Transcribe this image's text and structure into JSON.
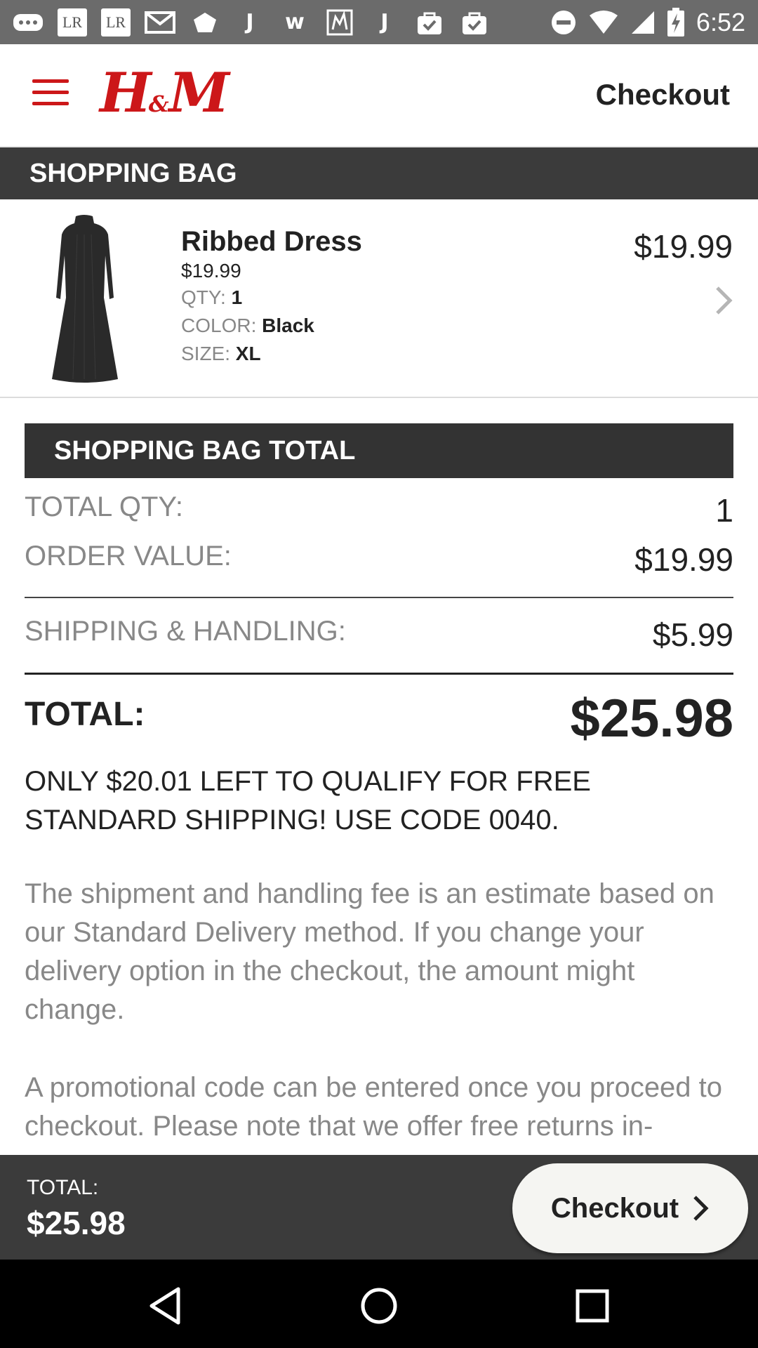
{
  "status_bar": {
    "time": "6:52",
    "icons": [
      "more-icon",
      "lr-icon",
      "lr-icon",
      "mail-icon",
      "shield-icon",
      "j-icon",
      "w-icon",
      "map-icon",
      "j-icon",
      "bag-check-icon",
      "bag-check-icon"
    ],
    "lr_label": "LR",
    "right_icons": [
      "do-not-disturb-icon",
      "wifi-icon",
      "signal-icon",
      "battery-charging-icon"
    ]
  },
  "header": {
    "brand_main": "H",
    "brand_amp": "&",
    "brand_end": "M",
    "title": "Checkout"
  },
  "shopping_bag": {
    "heading": "SHOPPING BAG",
    "items": [
      {
        "name": "Ribbed Dress",
        "unit_price": "$19.99",
        "qty_label": "QTY:",
        "qty": "1",
        "color_label": "COLOR:",
        "color": "Black",
        "size_label": "SIZE:",
        "size": "XL",
        "line_total": "$19.99"
      }
    ]
  },
  "totals": {
    "heading": "SHOPPING BAG TOTAL",
    "total_qty_label": "TOTAL QTY:",
    "total_qty": "1",
    "order_value_label": "ORDER VALUE:",
    "order_value": "$19.99",
    "shipping_label": "SHIPPING & HANDLING:",
    "shipping": "$5.99",
    "total_label": "TOTAL:",
    "total": "$25.98"
  },
  "messages": {
    "free_shipping": "ONLY $20.01 LEFT TO QUALIFY FOR FREE STANDARD SHIPPING! USE CODE 0040.",
    "shipping_estimate": "The shipment and handling fee is an estimate based on our Standard Delivery method. If you change your delivery option in the checkout, the amount might change.",
    "promo_code": "A promotional code can be entered once you proceed to checkout. Please note that we offer free returns in-"
  },
  "bottom_bar": {
    "total_label": "TOTAL:",
    "total": "$25.98",
    "checkout_label": "Checkout"
  },
  "colors": {
    "brand_red": "#cc1719",
    "dark_bar": "#3b3b3b",
    "status_bar": "#6b6b6b"
  }
}
